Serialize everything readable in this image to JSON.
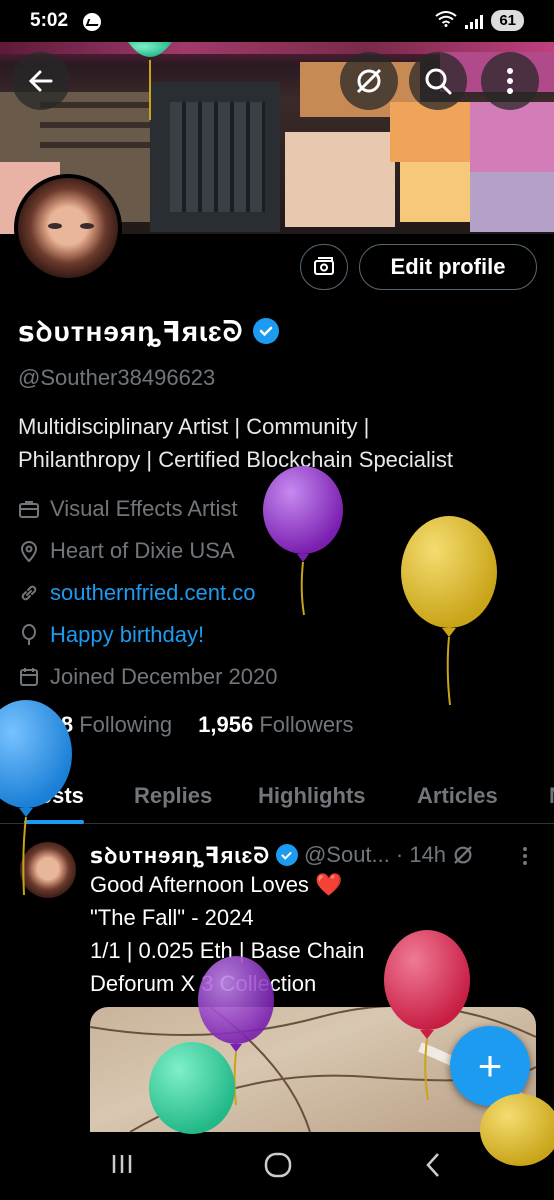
{
  "status_bar": {
    "time": "5:02",
    "battery": "61"
  },
  "profile": {
    "display_name": "ꜱꝺᴜᴛнɘᴙȵꟻᴙɩɛᘐ",
    "handle": "@Souther38496623",
    "bio": [
      "Multidisciplinary Artist | Community |",
      "Philanthropy | Certified Blockchain Specialist"
    ],
    "profession": "Visual Effects Artist",
    "location": "Heart of Dixie USA",
    "website": "southernfried.cent.co",
    "birthday": "Happy birthday!",
    "joined": "Joined December 2020",
    "following_count": "1,808",
    "following_label": "Following",
    "followers_count": "1,956",
    "followers_label": "Followers",
    "edit_button": "Edit profile"
  },
  "tabs": [
    "Posts",
    "Replies",
    "Highlights",
    "Articles",
    "M"
  ],
  "post": {
    "author": "ꜱꝺᴜᴛнɘᴙȵꟻᴙɩɛᘐ",
    "handle": "@Sout...",
    "time": "· 14h",
    "lines": [
      "Good Afternoon  Loves ❤️",
      "\"The Fall\" - 2024",
      "1/1 | 0.025 Eth | Base Chain",
      "Deforum X 3 Collection"
    ]
  },
  "icons": {
    "back": "arrow-left-icon",
    "grok": "grok-icon",
    "search": "search-icon",
    "more": "more-vertical-icon",
    "compose": "plus-icon"
  },
  "colors": {
    "accent": "#1d9bf0",
    "muted": "#71767b",
    "background": "#000000"
  }
}
